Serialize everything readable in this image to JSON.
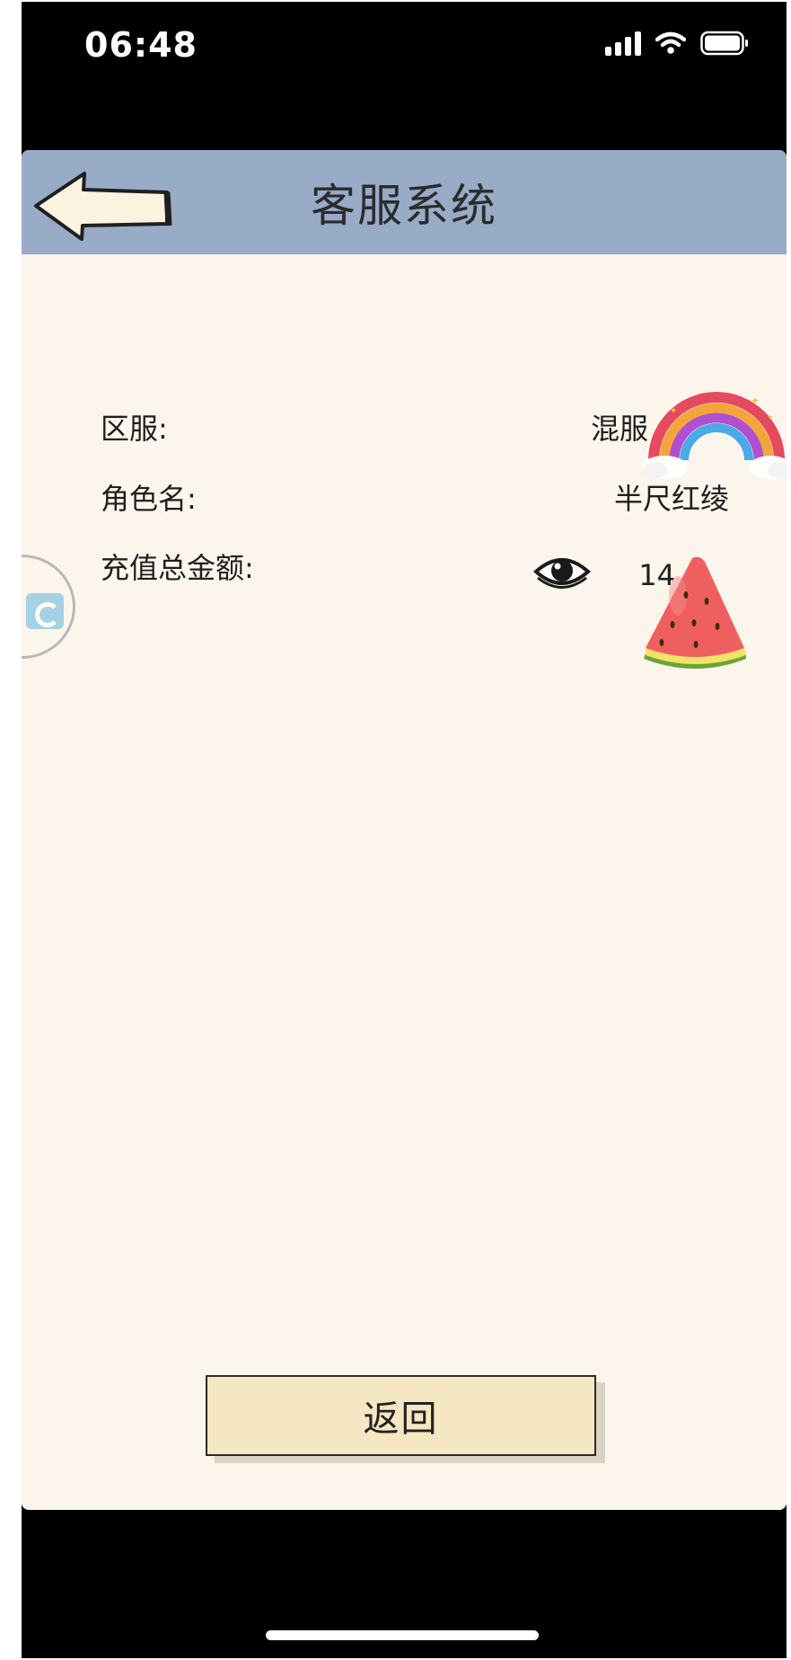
{
  "status_bar": {
    "time": "06:48"
  },
  "header": {
    "title": "客服系统",
    "back_icon": "left-arrow-icon"
  },
  "info": {
    "server_label": "区服:",
    "server_value": "混服",
    "role_label": "角色名:",
    "role_value": "半尺红绫",
    "recharge_label": "充值总金额:",
    "recharge_value": "14",
    "toggle_icon": "eye-icon"
  },
  "footer": {
    "return_label": "返回"
  },
  "colors": {
    "header_bg": "#98abc7",
    "page_bg": "#fcf5ec",
    "button_bg": "#f5e7c1"
  }
}
